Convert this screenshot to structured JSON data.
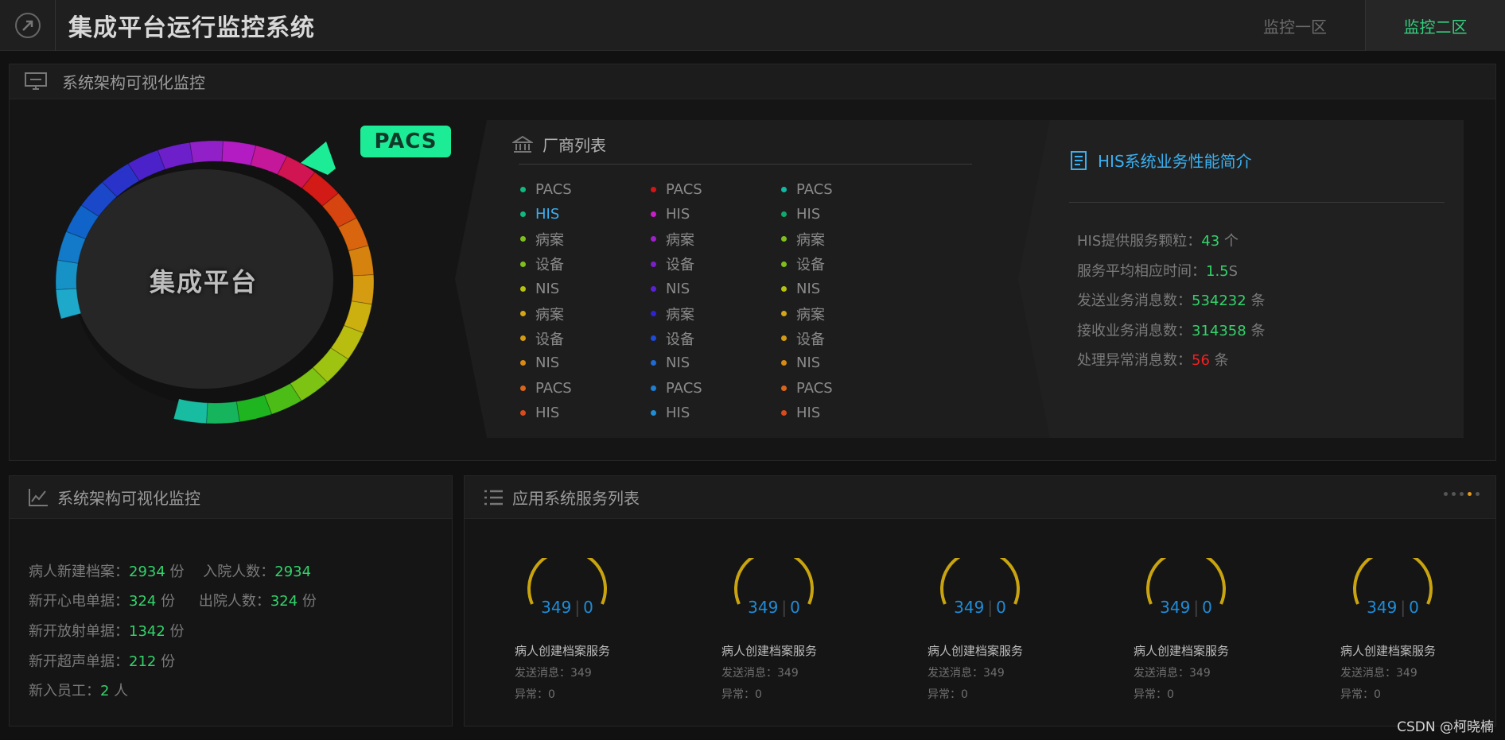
{
  "header": {
    "title": "集成平台运行监控系统",
    "tabs": [
      {
        "label": "监控一区",
        "active": false
      },
      {
        "label": "监控二区",
        "active": true
      }
    ],
    "logo_icon": "compass-arrow-icon"
  },
  "architecture": {
    "title": "系统架构可视化监控",
    "hub_label": "集成平台",
    "badge": "PACS",
    "vendor_title": "厂商列表",
    "vendor_columns": [
      {
        "colors": [
          "#10b981",
          "#10b981",
          "#7fbf1b",
          "#7fbf1b",
          "#b5c10d",
          "#d4a514",
          "#d49a14",
          "#d98a14",
          "#d9651a",
          "#d94a1c"
        ],
        "items": [
          "PACS",
          "HIS",
          "病案",
          "设备",
          "NIS",
          "病案",
          "设备",
          "NIS",
          "PACS",
          "HIS"
        ]
      },
      {
        "colors": [
          "#d41515",
          "#c91ec9",
          "#9b22c9",
          "#7b1fc9",
          "#5a22d4",
          "#2f22d4",
          "#1f4ad4",
          "#1f6ad4",
          "#1f7ed4",
          "#1f8ed4"
        ],
        "items": [
          "PACS",
          "HIS",
          "病案",
          "设备",
          "NIS",
          "病案",
          "设备",
          "NIS",
          "PACS",
          "HIS"
        ]
      },
      {
        "colors": [
          "#10b9a5",
          "#10a96b",
          "#7fbf1b",
          "#7fbf1b",
          "#b5c10d",
          "#d4a514",
          "#d49a14",
          "#d98a14",
          "#d9651a",
          "#d94a1c"
        ],
        "items": [
          "PACS",
          "HIS",
          "病案",
          "设备",
          "NIS",
          "病案",
          "设备",
          "NIS",
          "PACS",
          "HIS"
        ]
      }
    ],
    "highlighted_vendor": "HIS",
    "highlight_color": "#3ab0f0"
  },
  "perf": {
    "title": "HIS系统业务性能简介",
    "rows": [
      {
        "label": "HIS提供服务颗粒：",
        "value": "43",
        "unit": " 个",
        "color": "green"
      },
      {
        "label": "服务平均相应时间：",
        "value": "1.5",
        "unit": "S",
        "color": "green"
      },
      {
        "label": "发送业务消息数：",
        "value": "534232",
        "unit": " 条",
        "color": "green"
      },
      {
        "label": "接收业务消息数：",
        "value": "314358",
        "unit": " 条",
        "color": "green"
      },
      {
        "label": "处理异常消息数：",
        "value": "56",
        "unit": " 条",
        "color": "red"
      }
    ]
  },
  "patients": {
    "title": "系统架构可视化监控",
    "rows": [
      [
        {
          "label": "病人新建档案：",
          "value": "2934",
          "unit": " 份"
        },
        {
          "label": "入院人数：",
          "value": "2934",
          "unit": ""
        }
      ],
      [
        {
          "label": "新开心电单据：",
          "value": "324",
          "unit": " 份"
        },
        {
          "label": "出院人数：",
          "value": "324",
          "unit": " 份"
        }
      ],
      [
        {
          "label": "新开放射单据：",
          "value": "1342",
          "unit": " 份"
        }
      ],
      [
        {
          "label": "新开超声单据：",
          "value": "212",
          "unit": " 份"
        }
      ],
      [
        {
          "label": "新入员工：",
          "value": "2",
          "unit": " 人"
        }
      ]
    ]
  },
  "services": {
    "title": "应用系统服务列表",
    "cards": [
      {
        "sent": "349",
        "errors": "0",
        "name": "病人创建档案服务",
        "sent_line": "发送消息：349",
        "error_line": "异常：0"
      },
      {
        "sent": "349",
        "errors": "0",
        "name": "病人创建档案服务",
        "sent_line": "发送消息：349",
        "error_line": "异常：0"
      },
      {
        "sent": "349",
        "errors": "0",
        "name": "病人创建档案服务",
        "sent_line": "发送消息：349",
        "error_line": "异常：0"
      },
      {
        "sent": "349",
        "errors": "0",
        "name": "病人创建档案服务",
        "sent_line": "发送消息：349",
        "error_line": "异常：0"
      },
      {
        "sent": "349",
        "errors": "0",
        "name": "病人创建档案服务",
        "sent_line": "发送消息：349",
        "error_line": "异常：0"
      }
    ],
    "pager_active_index": 3,
    "pager_count": 5
  },
  "watermark": "CSDN @柯晓楠",
  "colors": {
    "accent_green": "#33d26a",
    "accent_blue": "#3ab0f0",
    "gauge_gold": "#c9a40f",
    "error_red": "#ee2222"
  }
}
